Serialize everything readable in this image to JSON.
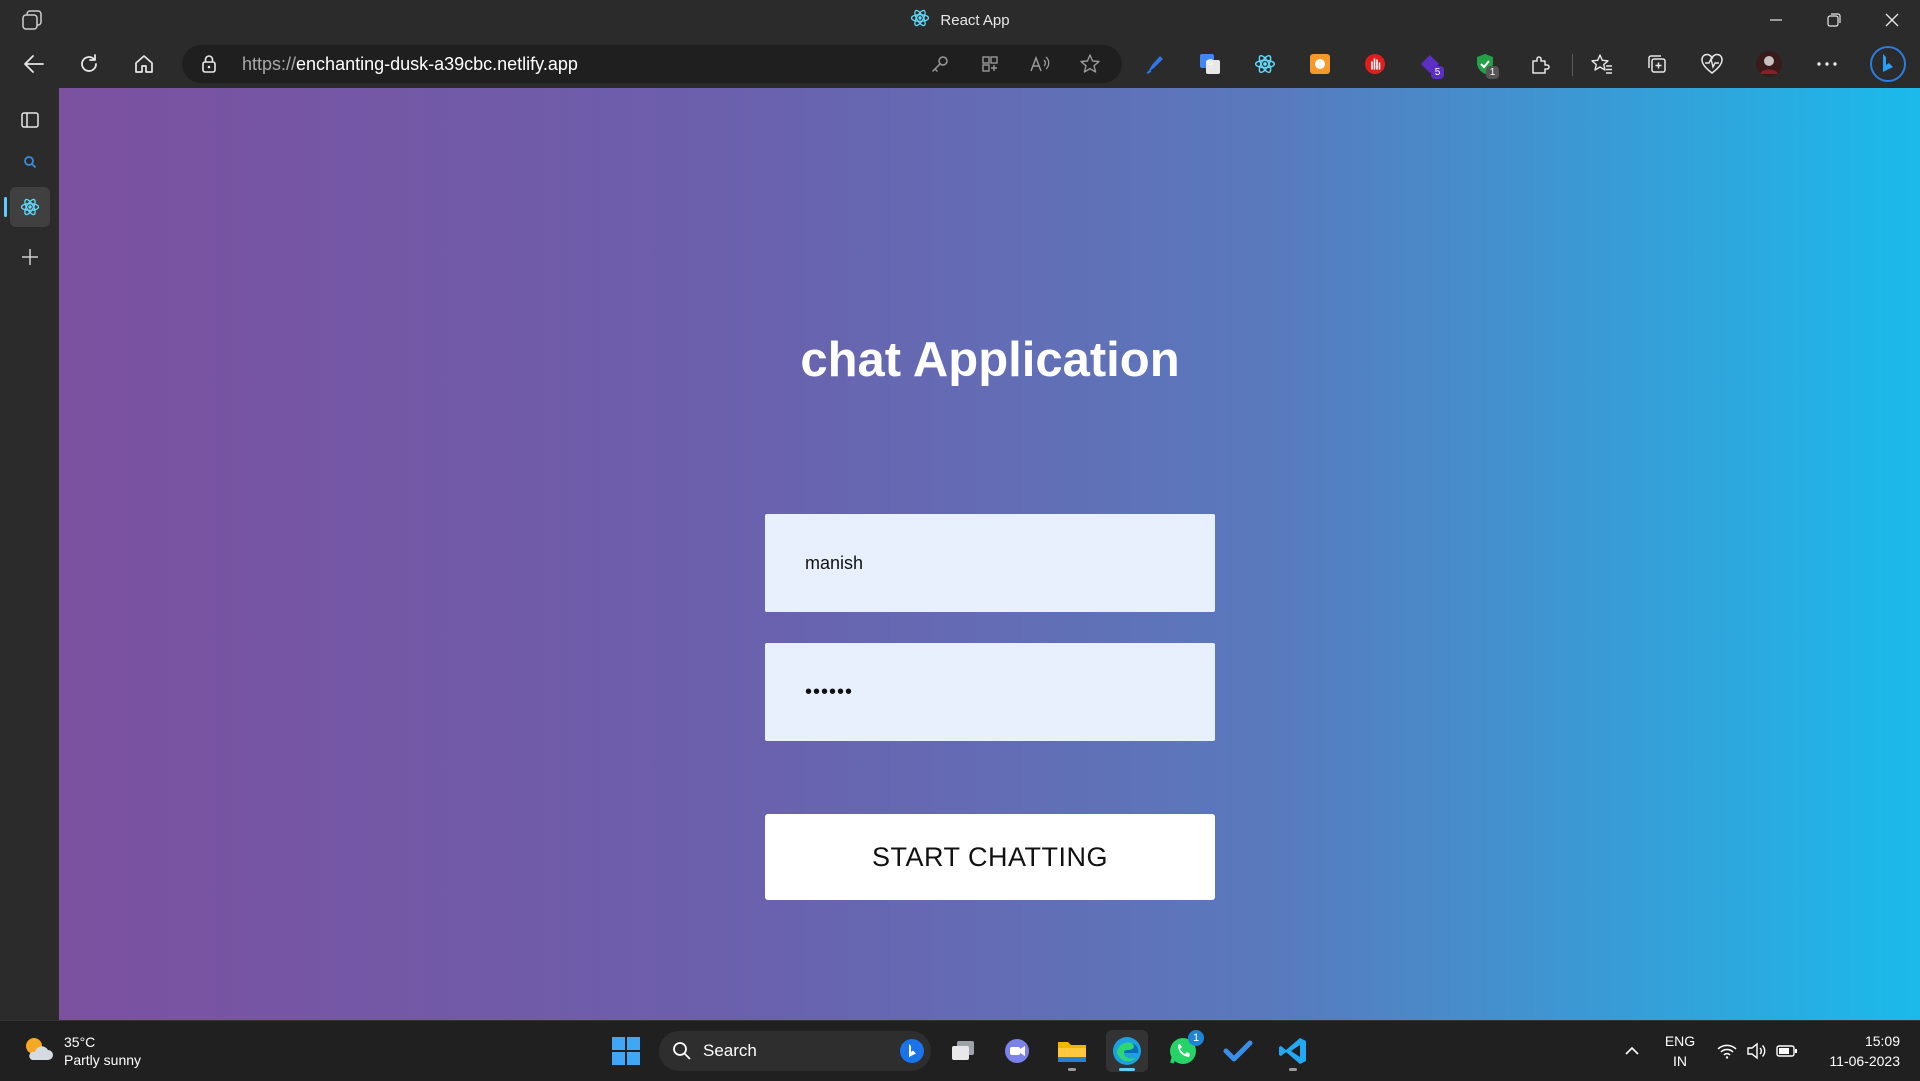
{
  "window": {
    "title": "React App"
  },
  "browser": {
    "url_protocol": "https://",
    "url_host": "enchanting-dusk-a39cbc.netlify.app",
    "extension_badges": {
      "ext6": "5",
      "ext7": "1"
    }
  },
  "page": {
    "heading": "chat Application",
    "username_value": "manish",
    "password_value": "••••••",
    "start_button_label": "START CHATTING"
  },
  "taskbar": {
    "weather_temp": "35°C",
    "weather_desc": "Partly sunny",
    "search_label": "Search",
    "whatsapp_badge": "1",
    "lang_line1": "ENG",
    "lang_line2": "IN",
    "time": "15:09",
    "date": "11-06-2023"
  },
  "colors": {
    "gradient_start": "#7b51a0",
    "gradient_end": "#1bbaeb",
    "input_bg": "#e8f0fe",
    "accent": "#60cdff"
  }
}
